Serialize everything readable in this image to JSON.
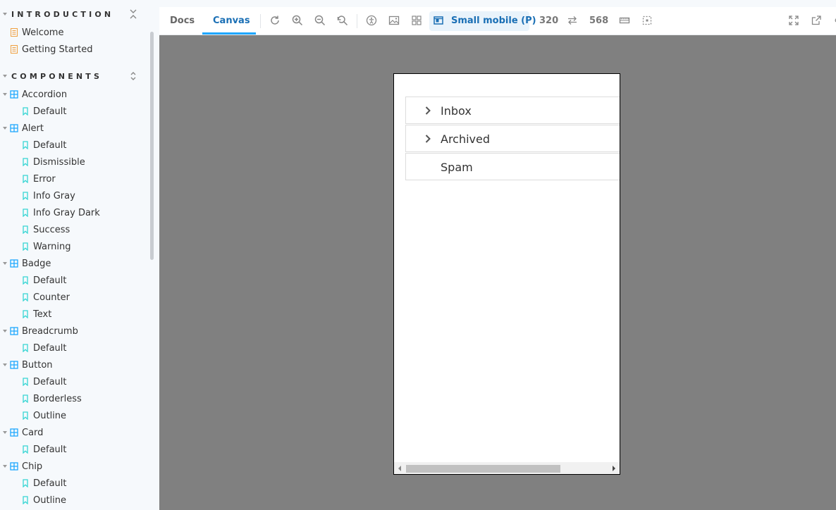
{
  "sidebar": {
    "sections": [
      {
        "title": "INTRODUCTION",
        "tool": "collapse-icon"
      },
      {
        "title": "COMPONENTS",
        "tool": "expand-collapse-icon"
      }
    ],
    "intro_items": [
      {
        "label": "Welcome",
        "icon": "document-icon"
      },
      {
        "label": "Getting Started",
        "icon": "document-icon"
      }
    ],
    "components": [
      {
        "label": "Accordion",
        "stories": [
          "Default"
        ]
      },
      {
        "label": "Alert",
        "stories": [
          "Default",
          "Dismissible",
          "Error",
          "Info Gray",
          "Info Gray Dark",
          "Success",
          "Warning"
        ]
      },
      {
        "label": "Badge",
        "stories": [
          "Default",
          "Counter",
          "Text"
        ]
      },
      {
        "label": "Breadcrumb",
        "stories": [
          "Default"
        ]
      },
      {
        "label": "Button",
        "stories": [
          "Default",
          "Borderless",
          "Outline"
        ]
      },
      {
        "label": "Card",
        "stories": [
          "Default"
        ]
      },
      {
        "label": "Chip",
        "stories": [
          "Default",
          "Outline"
        ]
      }
    ]
  },
  "toolbar": {
    "tabs": [
      "Docs",
      "Canvas"
    ],
    "active_tab": "Canvas",
    "viewport_label": "Small mobile (P)",
    "width": "320",
    "height": "568"
  },
  "canvas": {
    "accordion": [
      {
        "label": "Inbox",
        "expandable": true
      },
      {
        "label": "Archived",
        "expandable": true
      },
      {
        "label": "Spam",
        "expandable": false
      }
    ]
  },
  "colors": {
    "accent": "#1ea7fd",
    "active_text": "#1a6fb5",
    "document_icon": "#f0a040",
    "component_icon": "#1ea7fd",
    "story_icon": "#37d5d3",
    "canvas_bg": "#808080"
  }
}
